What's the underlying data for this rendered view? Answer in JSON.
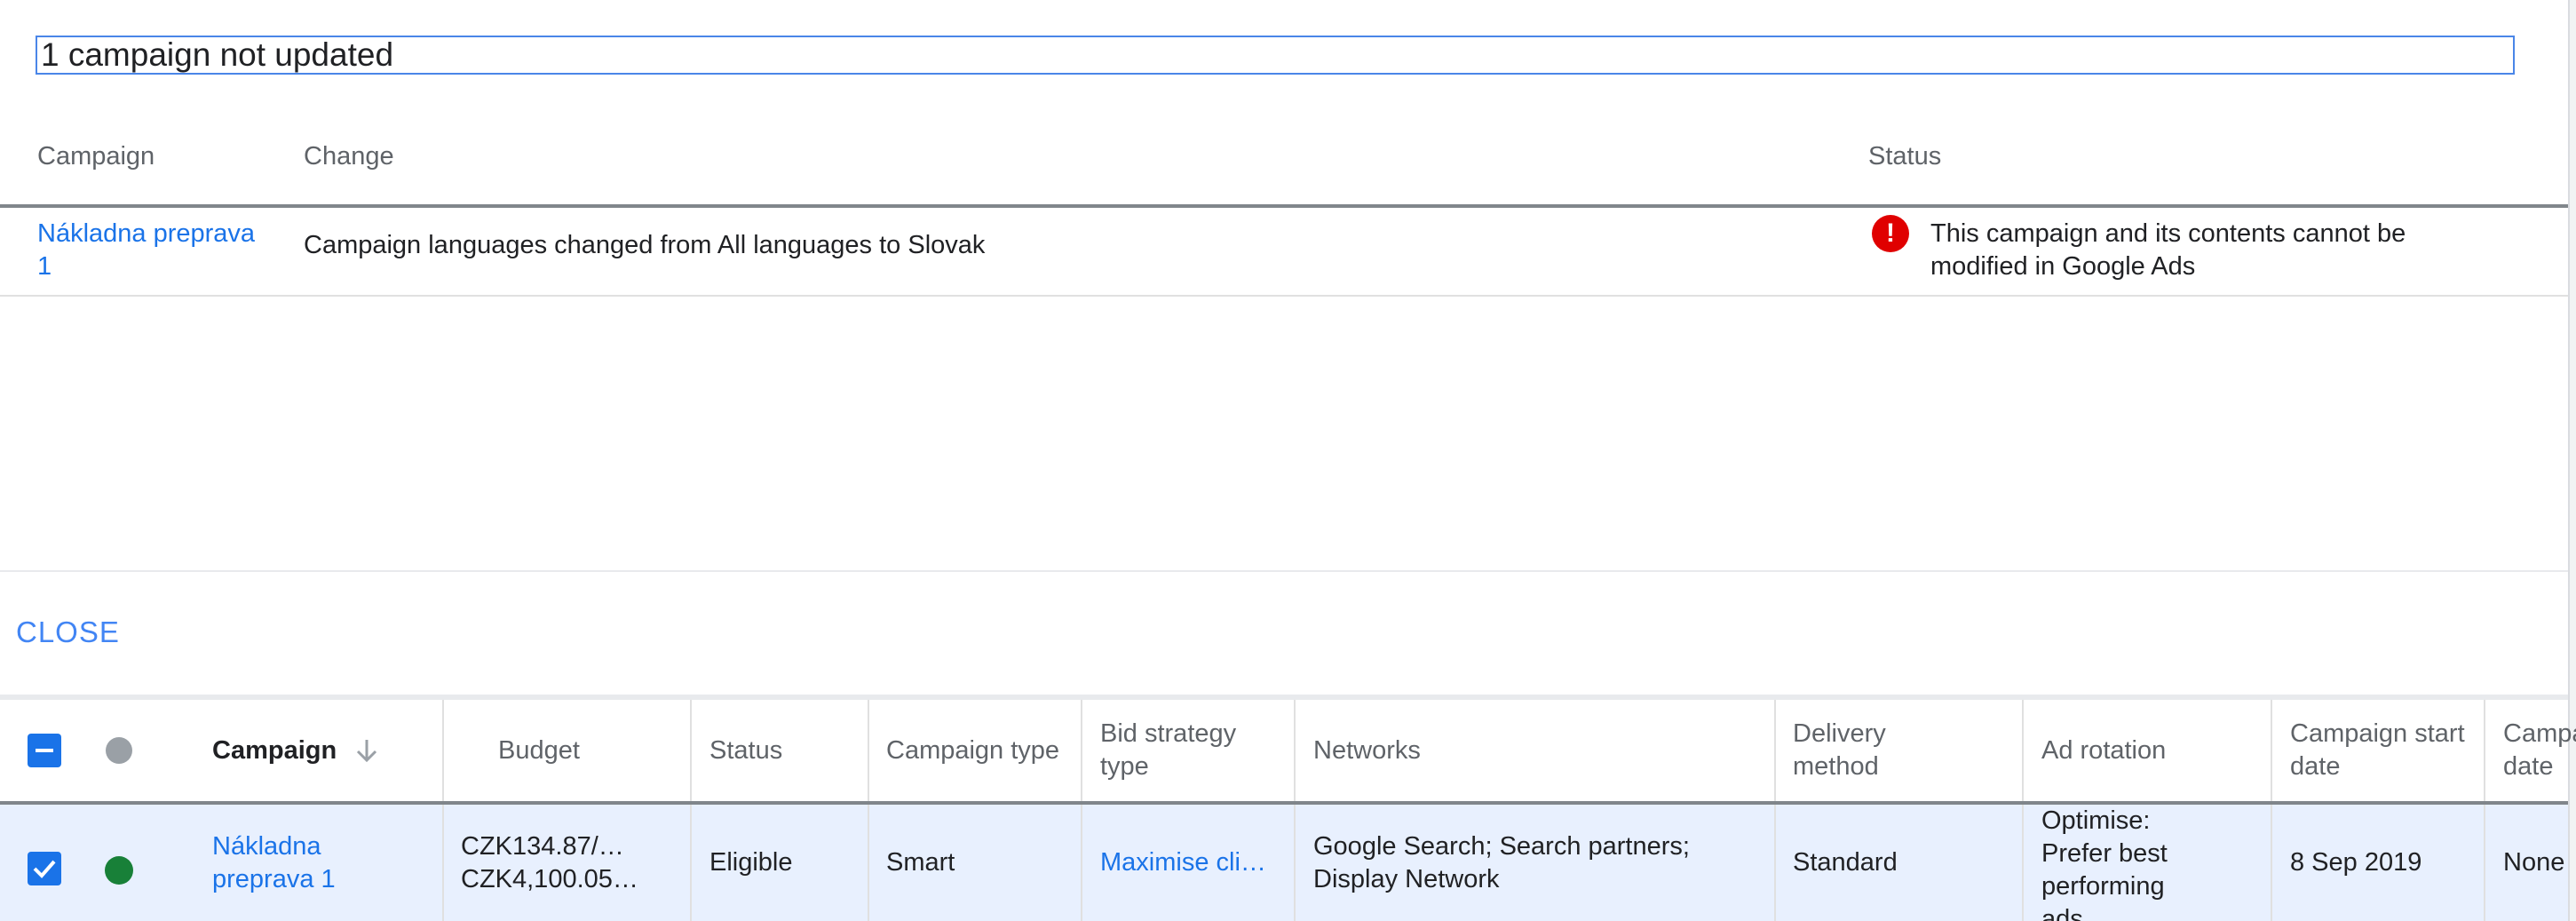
{
  "dialog": {
    "title": "1 campaign not updated",
    "columns": {
      "campaign": "Campaign",
      "change": "Change",
      "status": "Status"
    },
    "row": {
      "campaign": "Nákladna preprava 1",
      "change": "Campaign languages changed from All languages to Slovak",
      "status": "This campaign and its contents cannot be modified in Google Ads"
    },
    "close_label": "CLOSE"
  },
  "table": {
    "headers": {
      "campaign": "Campaign",
      "budget": "Budget",
      "status": "Status",
      "campaign_type": "Campaign type",
      "bid_strategy_type": "Bid strategy type",
      "networks": "Networks",
      "delivery_method": "Delivery method",
      "ad_rotation": "Ad rotation",
      "campaign_start_date": "Campaign start date",
      "campaign_end_date": "Campaign end date"
    },
    "row": {
      "campaign": "Nákladna preprava 1",
      "budget_line1": "CZK134.87/…",
      "budget_line2": "CZK4,100.05…",
      "status": "Eligible",
      "campaign_type": "Smart",
      "bid_strategy_type": "Maximise cli…",
      "networks": "Google Search; Search partners; Display Network",
      "delivery_method": "Standard",
      "ad_rotation": "Optimise: Prefer best performing ads",
      "campaign_start_date": "8 Sep 2019",
      "campaign_end_date": "None"
    }
  },
  "colors": {
    "accent": "#1a73e8",
    "error": "#e00000",
    "eligible_green": "#188038",
    "selected_row": "#e8f0fe"
  }
}
